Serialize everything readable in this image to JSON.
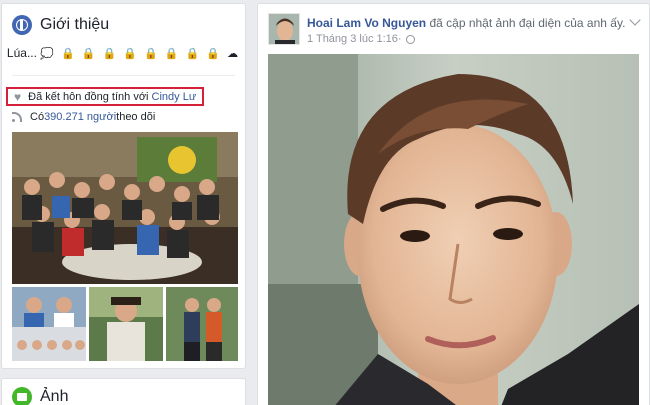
{
  "intro": {
    "title": "Giới thiệu",
    "bio": "Lúa...",
    "bio_emoji": "💭 🔒 🔒 🔒 🔒 🔒 🔒 🔒 🔒 ☁",
    "married_prefix": "Đã kết hôn đồng tính với ",
    "married_name": "Cindy Lư",
    "followers_prefix": "Có ",
    "followers_count": "390.271 người",
    "followers_suffix": " theo dõi"
  },
  "photos_section": {
    "title": "Ảnh"
  },
  "post": {
    "author": "Hoai Lam Vo Nguyen",
    "action": " đã cập nhật ảnh đại diện của anh ấy.",
    "timestamp": "1 Tháng 3 lúc 1:16",
    "separator": " · "
  },
  "colors": {
    "link": "#365899",
    "highlight_border": "#d5203a",
    "background": "#e9ebee"
  },
  "icons": {
    "intro": "globe-icon",
    "married": "heart-icon",
    "followers": "rss-icon",
    "photos": "photo-icon",
    "audience": "globe-small-icon",
    "menu": "chevron-down-icon"
  }
}
